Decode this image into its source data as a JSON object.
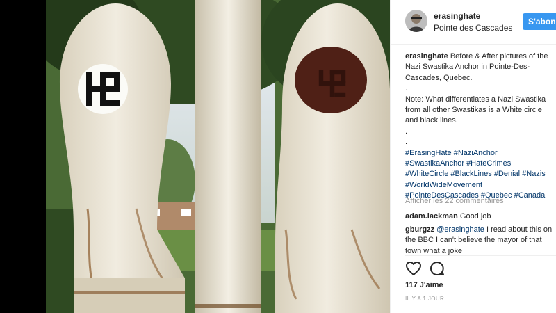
{
  "post": {
    "username": "erasinghate",
    "location": "Pointe des Cascades",
    "follow_label": "S'abonner"
  },
  "caption": {
    "username": "erasinghate",
    "text": "Before & After pictures of the Nazi Swastika Anchor in Pointe-Des-Cascades, Quebec.",
    "dot1": ".",
    "note": "Note: What differentiates a Nazi Swastika from all other Swastikas is a White circle and black lines.",
    "dot2": ".",
    "dot3": ".",
    "hashtags": [
      "#ErasingHate",
      "#NaziAnchor",
      "#SwastikaAnchor",
      "#HateCrimes",
      "#WhiteCircle",
      "#BlackLines",
      "#Denial",
      "#Nazis",
      "#WorldWideMovement",
      "#PointeDesCascades",
      "#Quebec",
      "#Canada"
    ]
  },
  "comments": {
    "view_all": "Afficher les 22 commentaires",
    "items": [
      {
        "username": "adam.lackman",
        "mention": "",
        "text": "Good job"
      },
      {
        "username": "gburgzz",
        "mention": "@erasinghate",
        "text": "I read about this on the BBC I can't believe the mayor of that town what a joke"
      }
    ]
  },
  "actions": {
    "like_icon": "heart-icon",
    "comment_icon": "comment-bubble-icon",
    "likes": "117 J'aime",
    "time": "IL Y A 1 JOUR"
  },
  "colors": {
    "accent": "#3897f0",
    "link": "#003569",
    "muted": "#999999"
  }
}
